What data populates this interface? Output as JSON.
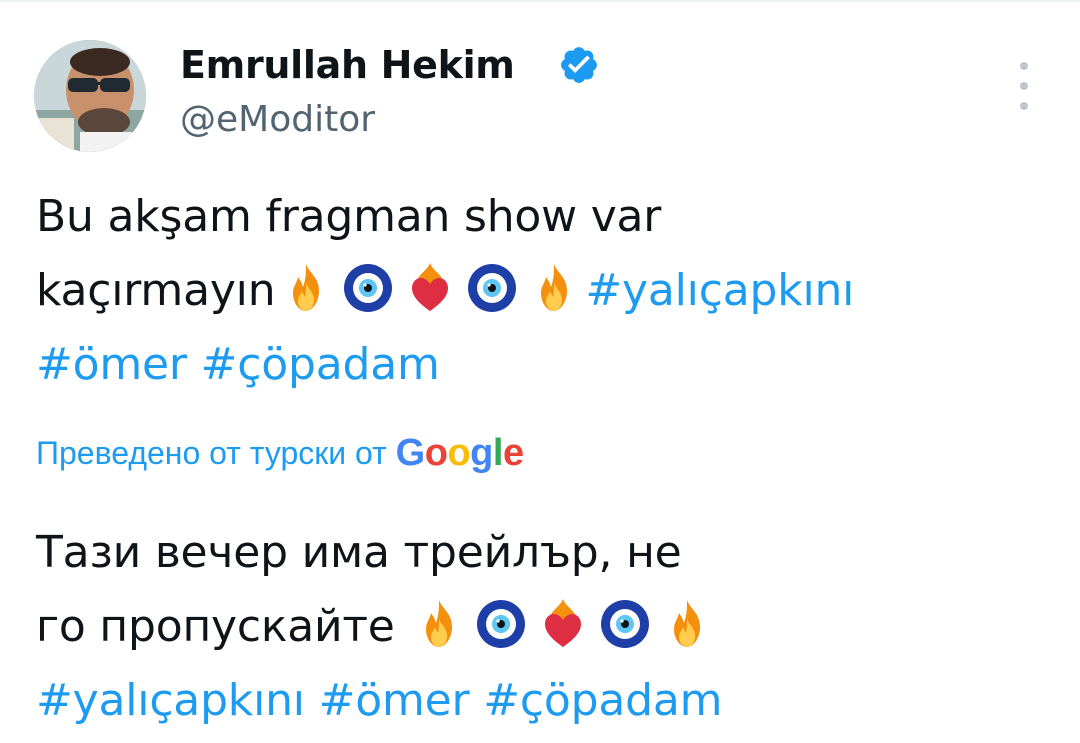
{
  "author": {
    "name": "Emrullah Hekim",
    "handle": "@eModitor",
    "verified": true,
    "avatar_icon": "profile-photo"
  },
  "menu": {
    "icon": "more-vertical-icon"
  },
  "tweet": {
    "original": {
      "line1": "Bu akşam fragman show var",
      "line2_text": "kaçırmayın",
      "emojis": [
        "fire",
        "nazar-amulet",
        "heart-on-fire",
        "nazar-amulet",
        "fire"
      ],
      "hashtag1": "#yalıçapkını",
      "hashtag2": "#ömer",
      "hashtag3": "#çöpadam"
    },
    "translation_label": "Преведено от турски от",
    "translation_provider": {
      "letters": [
        "G",
        "o",
        "o",
        "g",
        "l",
        "e"
      ]
    },
    "translated": {
      "line1": "Тази вечер има трейлър, не",
      "line2_text": "го пропускайте",
      "emojis": [
        "fire",
        "nazar-amulet",
        "heart-on-fire",
        "nazar-amulet",
        "fire"
      ],
      "hashtag1": "#yalıçapkını",
      "hashtag2": "#ömer",
      "hashtag3": "#çöpadam"
    }
  },
  "colors": {
    "hashtag": "#1d9bf0",
    "text": "#0f1419",
    "secondary": "#536471",
    "verified": "#1d9bf0"
  }
}
